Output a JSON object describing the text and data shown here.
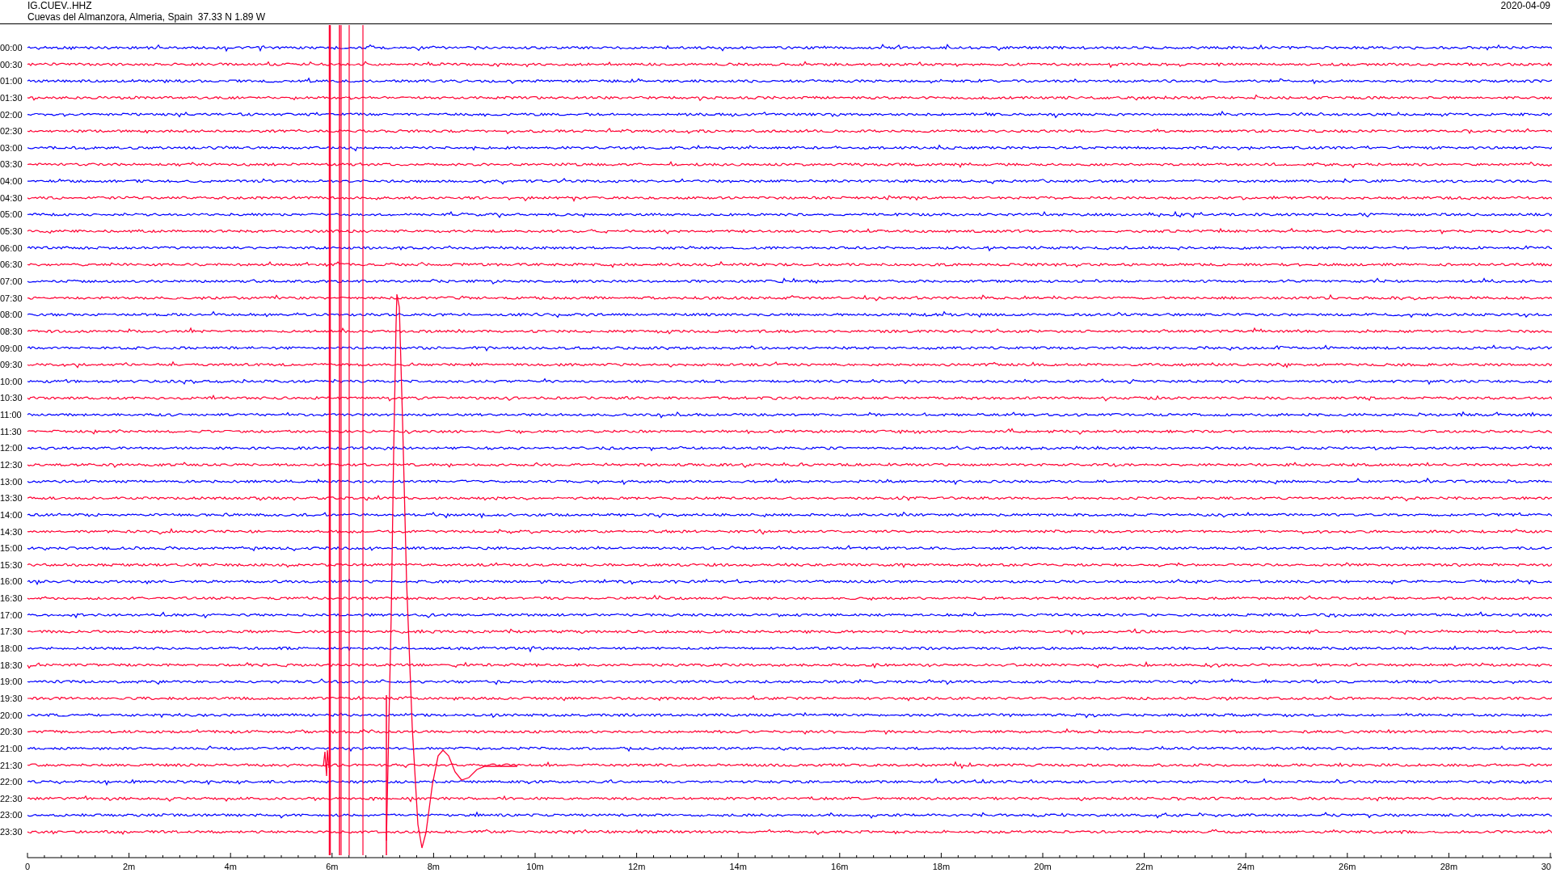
{
  "header": {
    "station": "IG.CUEV..HHZ",
    "location": "Cuevas del Almanzora, Almeria, Spain  37.33 N 1.89 W",
    "date": "2020-04-09"
  },
  "rows": [
    {
      "label": "00:00",
      "color": "#0000ff"
    },
    {
      "label": "00:30",
      "color": "#ff0033"
    },
    {
      "label": "01:00",
      "color": "#0000ff"
    },
    {
      "label": "01:30",
      "color": "#ff0033"
    },
    {
      "label": "02:00",
      "color": "#0000ff"
    },
    {
      "label": "02:30",
      "color": "#ff0033"
    },
    {
      "label": "03:00",
      "color": "#0000ff"
    },
    {
      "label": "03:30",
      "color": "#ff0033"
    },
    {
      "label": "04:00",
      "color": "#0000ff"
    },
    {
      "label": "04:30",
      "color": "#ff0033"
    },
    {
      "label": "05:00",
      "color": "#0000ff"
    },
    {
      "label": "05:30",
      "color": "#ff0033"
    },
    {
      "label": "06:00",
      "color": "#0000ff"
    },
    {
      "label": "06:30",
      "color": "#ff0033"
    },
    {
      "label": "07:00",
      "color": "#0000ff"
    },
    {
      "label": "07:30",
      "color": "#ff0033"
    },
    {
      "label": "08:00",
      "color": "#0000ff"
    },
    {
      "label": "08:30",
      "color": "#ff0033"
    },
    {
      "label": "09:00",
      "color": "#0000ff"
    },
    {
      "label": "09:30",
      "color": "#ff0033"
    },
    {
      "label": "10:00",
      "color": "#0000ff"
    },
    {
      "label": "10:30",
      "color": "#ff0033"
    },
    {
      "label": "11:00",
      "color": "#0000ff"
    },
    {
      "label": "11:30",
      "color": "#ff0033"
    },
    {
      "label": "12:00",
      "color": "#0000ff"
    },
    {
      "label": "12:30",
      "color": "#ff0033"
    },
    {
      "label": "13:00",
      "color": "#0000ff"
    },
    {
      "label": "13:30",
      "color": "#ff0033"
    },
    {
      "label": "14:00",
      "color": "#0000ff"
    },
    {
      "label": "14:30",
      "color": "#ff0033"
    },
    {
      "label": "15:00",
      "color": "#0000ff"
    },
    {
      "label": "15:30",
      "color": "#ff0033"
    },
    {
      "label": "16:00",
      "color": "#0000ff"
    },
    {
      "label": "16:30",
      "color": "#ff0033"
    },
    {
      "label": "17:00",
      "color": "#0000ff"
    },
    {
      "label": "17:30",
      "color": "#ff0033"
    },
    {
      "label": "18:00",
      "color": "#0000ff"
    },
    {
      "label": "18:30",
      "color": "#ff0033"
    },
    {
      "label": "19:00",
      "color": "#0000ff"
    },
    {
      "label": "19:30",
      "color": "#ff0033"
    },
    {
      "label": "20:00",
      "color": "#0000ff"
    },
    {
      "label": "20:30",
      "color": "#ff0033"
    },
    {
      "label": "21:00",
      "color": "#0000ff"
    },
    {
      "label": "21:30",
      "color": "#ff0033"
    },
    {
      "label": "22:00",
      "color": "#0000ff"
    },
    {
      "label": "22:30",
      "color": "#ff0033"
    },
    {
      "label": "23:00",
      "color": "#0000ff"
    },
    {
      "label": "23:30",
      "color": "#ff0033"
    }
  ],
  "x_axis": {
    "ticks": [
      "0",
      "2m",
      "4m",
      "6m",
      "8m",
      "10m",
      "12m",
      "14m",
      "16m",
      "18m",
      "20m",
      "22m",
      "24m",
      "26m",
      "28m",
      "30"
    ]
  }
}
